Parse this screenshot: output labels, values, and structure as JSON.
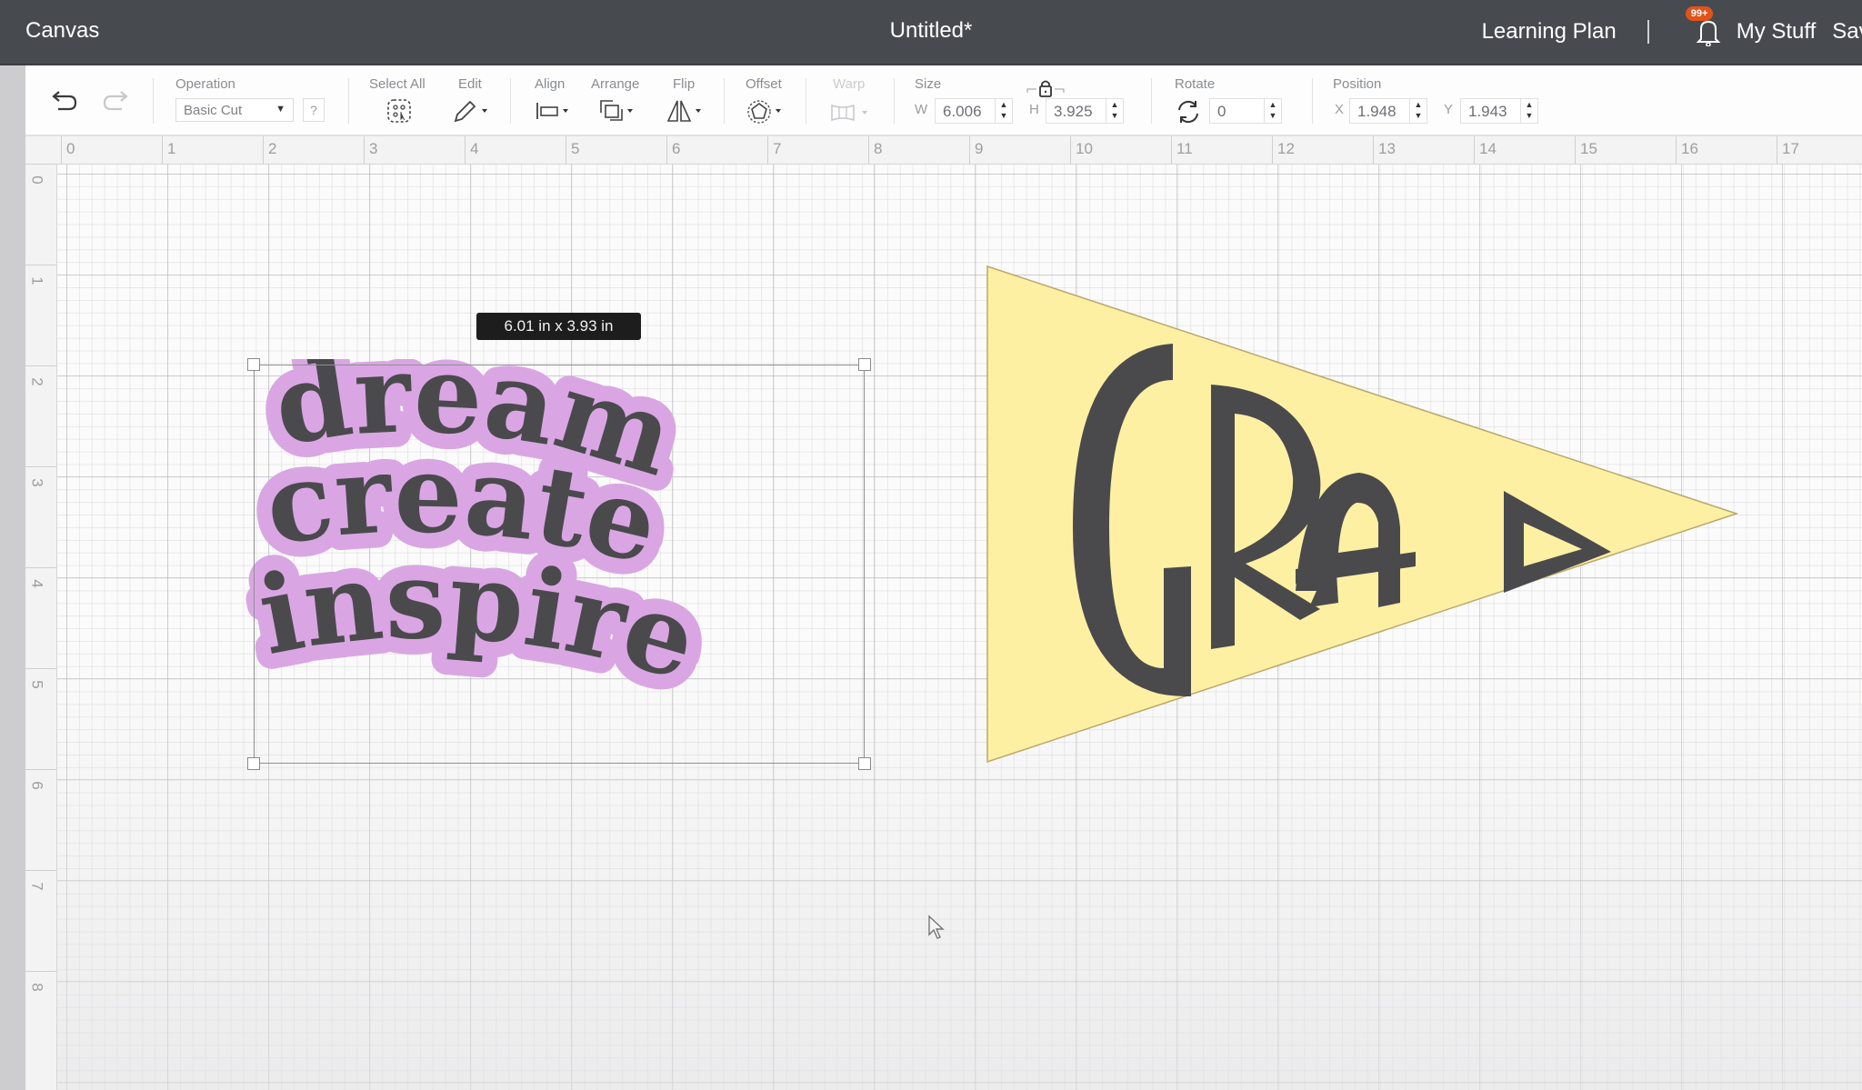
{
  "topbar": {
    "app_name": "Canvas",
    "document_title": "Untitled*",
    "learning_plan": "Learning Plan",
    "notification_badge": "99+",
    "my_stuff": "My Stuff",
    "save": "Save"
  },
  "toolbar": {
    "operation": {
      "label": "Operation",
      "value": "Basic Cut",
      "help": "?"
    },
    "select_all": {
      "label": "Select All"
    },
    "edit": {
      "label": "Edit"
    },
    "align": {
      "label": "Align"
    },
    "arrange": {
      "label": "Arrange"
    },
    "flip": {
      "label": "Flip"
    },
    "offset": {
      "label": "Offset"
    },
    "warp": {
      "label": "Warp",
      "disabled": true
    },
    "size": {
      "label": "Size",
      "w_label": "W",
      "w_value": "6.006",
      "h_label": "H",
      "h_value": "3.925",
      "locked": true
    },
    "rotate": {
      "label": "Rotate",
      "value": "0"
    },
    "position": {
      "label": "Position",
      "x_label": "X",
      "x_value": "1.948",
      "y_label": "Y",
      "y_value": "1.943"
    }
  },
  "rulers": {
    "horizontal": [
      "0",
      "1",
      "2",
      "3",
      "4",
      "5",
      "6",
      "7",
      "8",
      "9",
      "10",
      "11",
      "12",
      "13",
      "14",
      "15",
      "16",
      "17"
    ],
    "vertical": [
      "0",
      "1",
      "2",
      "3",
      "4",
      "5",
      "6",
      "7",
      "8"
    ]
  },
  "canvas": {
    "selection_tooltip": "6.01  in x 3.93  in",
    "designs": [
      {
        "name": "dream create inspire",
        "lines": [
          "dream",
          "create",
          "inspire"
        ],
        "fill_color": "#4a4a4d",
        "outline_color": "#d9a6e3",
        "selected": true
      },
      {
        "name": "GRAD pennant",
        "text": "GRAD",
        "fill_color": "#4a4a4d",
        "pennant_color": "#fdf0a3",
        "selected": false
      }
    ]
  },
  "colors": {
    "topbar_bg": "#474b50",
    "badge": "#e2531a"
  }
}
